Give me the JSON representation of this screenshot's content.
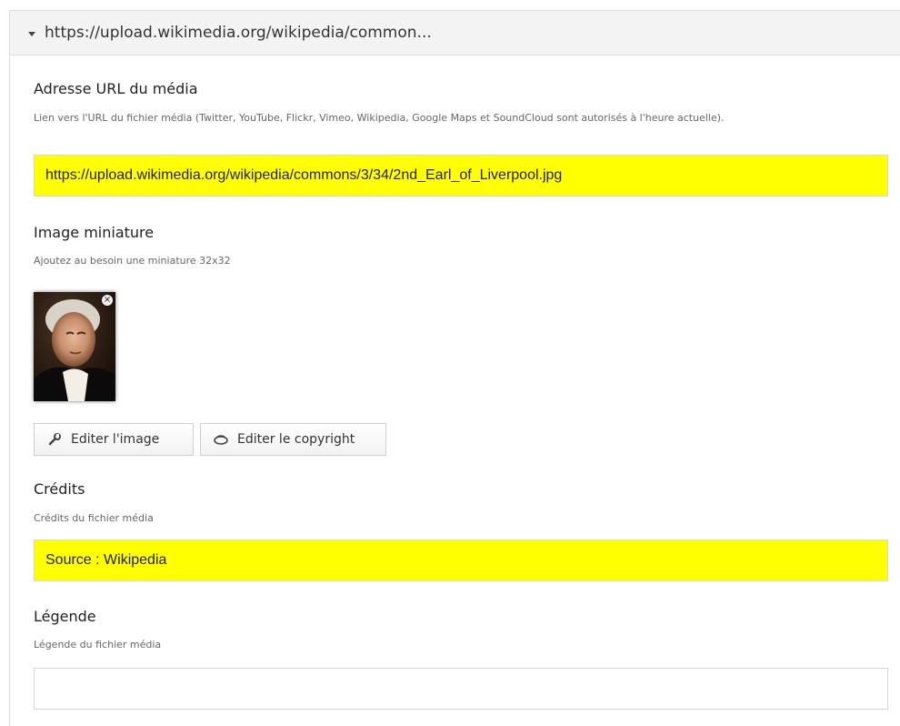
{
  "panel": {
    "header_title": "https://upload.wikimedia.org/wikipedia/common..."
  },
  "media_url": {
    "label": "Adresse URL du média",
    "help": "Lien vers l'URL du fichier média (Twitter, YouTube, Flickr, Vimeo, Wikipedia, Google Maps et SoundCloud sont autorisés à l'heure actuelle).",
    "value": "https://upload.wikimedia.org/wikipedia/commons/3/34/2nd_Earl_of_Liverpool.jpg"
  },
  "thumbnail": {
    "label": "Image miniature",
    "help": "Ajoutez au besoin une miniature 32x32"
  },
  "buttons": {
    "edit_image": "Editer l'image",
    "edit_copyright": "Editer le copyright"
  },
  "credits": {
    "label": "Crédits",
    "help": "Crédits du fichier média",
    "value": "Source : Wikipedia"
  },
  "caption": {
    "label": "Légende",
    "help": "Légende du fichier média",
    "value": ""
  },
  "colors": {
    "highlight": "#ffff00"
  }
}
